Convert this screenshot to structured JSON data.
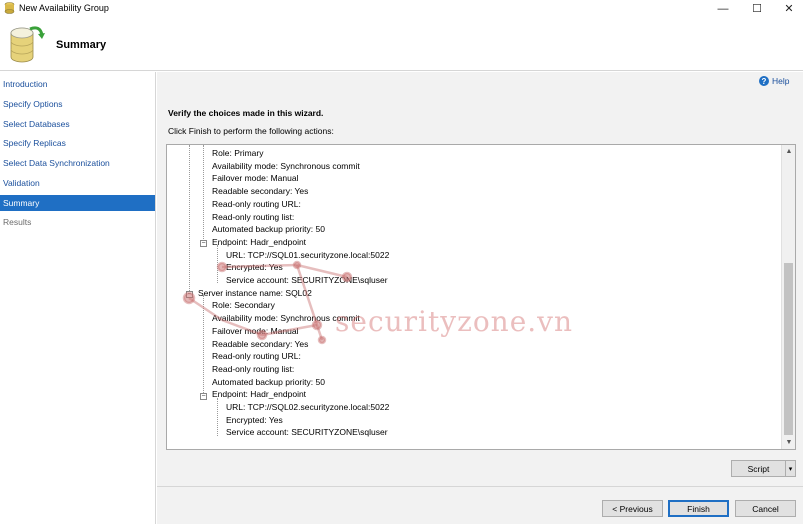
{
  "window": {
    "title": "New Availability Group",
    "minimize": "—",
    "maximize": "☐",
    "close": "✕"
  },
  "header": {
    "title": "Summary",
    "icon": "availability-group-wizard-icon"
  },
  "sidebar": {
    "items": [
      {
        "label": "Introduction",
        "state": "link"
      },
      {
        "label": "Specify Options",
        "state": "link"
      },
      {
        "label": "Select Databases",
        "state": "link"
      },
      {
        "label": "Specify Replicas",
        "state": "link"
      },
      {
        "label": "Select Data Synchronization",
        "state": "link"
      },
      {
        "label": "Validation",
        "state": "link"
      },
      {
        "label": "Summary",
        "state": "active"
      },
      {
        "label": "Results",
        "state": "disabled"
      }
    ]
  },
  "main": {
    "help_label": "Help",
    "help_glyph": "?",
    "instruction": "Verify the choices made in this wizard.",
    "subinstruction": "Click Finish to perform the following actions:",
    "tree_lines": [
      "Role: Primary",
      "Availability mode: Synchronous commit",
      "Failover mode: Manual",
      "Readable secondary: Yes",
      "Read-only routing URL:",
      "Read-only routing list:",
      "Automated backup priority: 50",
      "Endpoint: Hadr_endpoint",
      "URL: TCP://SQL01.securityzone.local:5022",
      "Encrypted: Yes",
      "Service account: SECURITYZONE\\sqluser",
      "Server instance name: SQL02",
      "Role: Secondary",
      "Availability mode: Synchronous commit",
      "Failover mode: Manual",
      "Readable secondary: Yes",
      "Read-only routing URL:",
      "Read-only routing list:",
      "Automated backup priority: 50",
      "Endpoint: Hadr_endpoint",
      "URL: TCP://SQL02.securityzone.local:5022",
      "Encrypted: Yes",
      "Service account: SECURITYZONE\\sqluser"
    ],
    "expander_collapse_glyph": "−",
    "scroll_up_glyph": "▲",
    "scroll_down_glyph": "▼",
    "watermark": "securityzone.vn"
  },
  "buttons": {
    "script": "Script",
    "script_arrow": "▾",
    "previous": "< Previous",
    "finish": "Finish",
    "cancel": "Cancel"
  },
  "colors": {
    "accent": "#1f6fc4",
    "link": "#1a4f9c",
    "pane_bg": "#f2f2f2"
  }
}
